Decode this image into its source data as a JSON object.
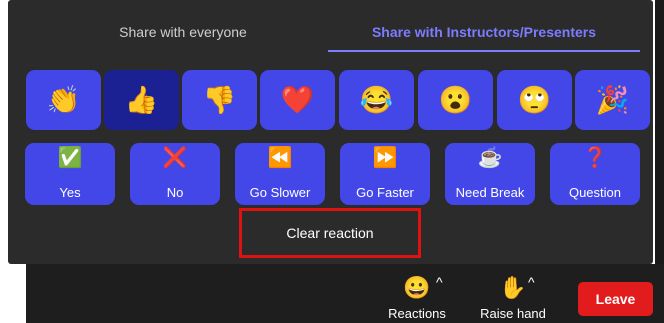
{
  "tabs": [
    {
      "label": "Share with everyone"
    },
    {
      "label": "Share with Instructors/Presenters"
    }
  ],
  "emoji_reactions": [
    {
      "icon": "👏",
      "name": "clapping-hands"
    },
    {
      "icon": "👍",
      "name": "thumbs-up"
    },
    {
      "icon": "👎",
      "name": "thumbs-down"
    },
    {
      "icon": "❤️",
      "name": "heart"
    },
    {
      "icon": "😂",
      "name": "tears-of-joy"
    },
    {
      "icon": "😮",
      "name": "open-mouth"
    },
    {
      "icon": "🙄",
      "name": "eye-roll"
    },
    {
      "icon": "🎉",
      "name": "party-popper"
    }
  ],
  "nonverbal_feedback": [
    {
      "icon": "✅",
      "label": "Yes"
    },
    {
      "icon": "❌",
      "label": "No"
    },
    {
      "icon": "⏪",
      "label": "Go Slower"
    },
    {
      "icon": "⏩",
      "label": "Go Faster"
    },
    {
      "icon": "☕",
      "label": "Need Break"
    },
    {
      "icon": "❓",
      "label": "Question"
    }
  ],
  "clear_reaction_label": "Clear reaction",
  "bottom_bar": {
    "reactions_label": "Reactions",
    "reactions_icon": "😀",
    "raise_hand_label": "Raise hand",
    "raise_hand_icon": "✋",
    "caret": "^",
    "leave_label": "Leave"
  },
  "colors": {
    "panel_bg": "#2b2b2b",
    "button_blue": "#4447e8",
    "button_active": "#1b2193",
    "accent_tab": "#7c7cff",
    "leave_red": "#e21c1c",
    "highlight_border": "#e01111"
  }
}
